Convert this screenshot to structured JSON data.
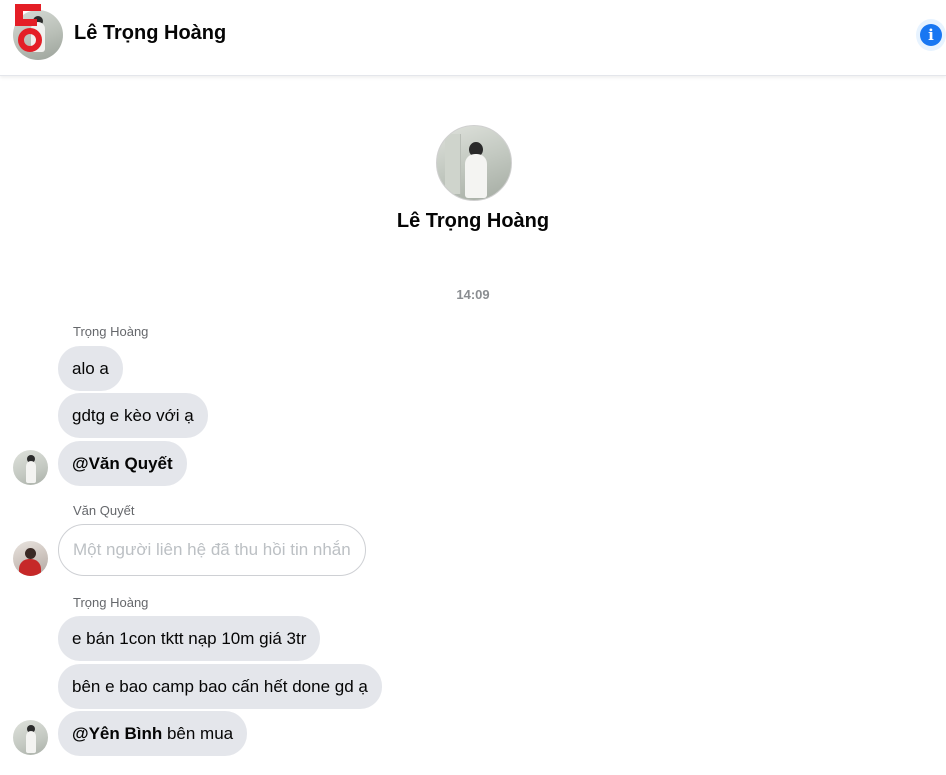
{
  "header": {
    "title": "Lê Trọng Hoàng",
    "info_icon": "info-icon",
    "info_glyph": "i",
    "accent_color": "#1877f2"
  },
  "profile": {
    "name": "Lê Trọng Hoàng"
  },
  "timestamp": "14:09",
  "groups": [
    {
      "sender": "Trọng Hoàng",
      "messages": [
        {
          "text": "alo a"
        },
        {
          "text": "gdtg e kèo với ạ"
        },
        {
          "mention": "@Văn Quyết",
          "text": ""
        }
      ]
    },
    {
      "sender": "Văn Quyết",
      "messages": [
        {
          "text": "Một người liên hệ đã thu hồi tin nhắn",
          "removed": true
        }
      ]
    },
    {
      "sender": "Trọng Hoàng",
      "messages": [
        {
          "text": "e bán 1con tktt nạp 10m giá 3tr"
        },
        {
          "text": "bên e bao camp bao cấn hết done gd ạ"
        },
        {
          "mention": "@Yên Bình",
          "text": " bên mua"
        }
      ]
    }
  ]
}
